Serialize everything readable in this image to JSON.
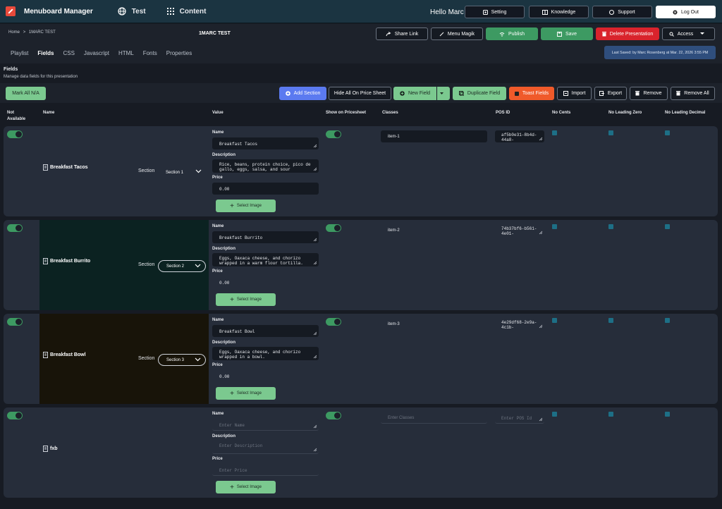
{
  "topbar": {
    "app_title": "Menuboard Manager",
    "nav_test": "Test",
    "nav_content": "Content",
    "greeting": "Hello Marc",
    "setting": "Setting",
    "knowledge": "Knowledge",
    "support": "Support",
    "logout": "Log Out"
  },
  "breadcrumb": {
    "home": "Home",
    "sep": ">",
    "current": "1MARC TEST"
  },
  "page_title": "1MARC TEST",
  "actions": {
    "share": "Share Link",
    "magik": "Menu Magik",
    "publish": "Publish",
    "save": "Save",
    "delete": "Delete Presentation",
    "access": "Access"
  },
  "tabs": [
    "Playlist",
    "Fields",
    "CSS",
    "Javascript",
    "HTML",
    "Fonts",
    "Properties"
  ],
  "last_saved": "Last Saved: by Marc Rosenberg at Mar. 22, 2026 3:55 PM",
  "fields_heading": "Fields",
  "fields_sub": "Manage data fields for this presentation",
  "toolbar": {
    "mark_all": "Mark All N/A",
    "add_section": "Add Section",
    "hide_all": "Hide All On Price Sheet",
    "new_field": "New Field",
    "duplicate": "Duplicate Field",
    "toast": "Toast Fields",
    "import": "Import",
    "export": "Export",
    "remove": "Remove",
    "remove_all": "Remove All"
  },
  "columns": {
    "not_available": "Not",
    "not_available2": "Available",
    "name": "Name",
    "value": "Value",
    "show": "Show on Pricesheet",
    "classes": "Classes",
    "pos": "POS ID",
    "no_cents": "No Cents",
    "no_lead_zero": "No Leading Zero",
    "no_lead_dec": "No Leading Decimal"
  },
  "labels": {
    "name": "Name",
    "description": "Description",
    "price": "Price",
    "select_image": "Select Image",
    "section": "Section"
  },
  "placeholders": {
    "name": "Enter Name",
    "description": "Enter Description",
    "price": "Enter Price",
    "classes": "Enter Classes",
    "pos": "Enter POS Id"
  },
  "rows": [
    {
      "title": "Breakfast Tacos",
      "section": "Section 1",
      "name": "Breakfast Tacos",
      "description": "Rice, beans, protein choice, pico de gallo, eggs, salsa, and sour",
      "price": "0.00",
      "classes": "item-1",
      "pos": "af5b0e31-8b4d-44a8-",
      "bg": "#262d3a"
    },
    {
      "title": "Breakfast Burrito",
      "section": "Section 2",
      "name": "Breakfast Burrito",
      "description": "Eggs, Oaxaca cheese, and chorizo wrapped in a warm flour tortilla.",
      "price": "0.00",
      "classes": "item-2",
      "pos": "74b37bf6-b561-4e01-",
      "bg": "#0b2221"
    },
    {
      "title": "Breakfast Bowl",
      "section": "Section 3",
      "name": "Breakfast Bowl",
      "description": "Eggs, Oaxaca cheese, and chorizo wrapped in a bowl.",
      "price": "0.00",
      "classes": "item-3",
      "pos": "4e29df68-2e9a-4c1b-",
      "bg": "#181409"
    },
    {
      "title": "fxb"
    }
  ]
}
